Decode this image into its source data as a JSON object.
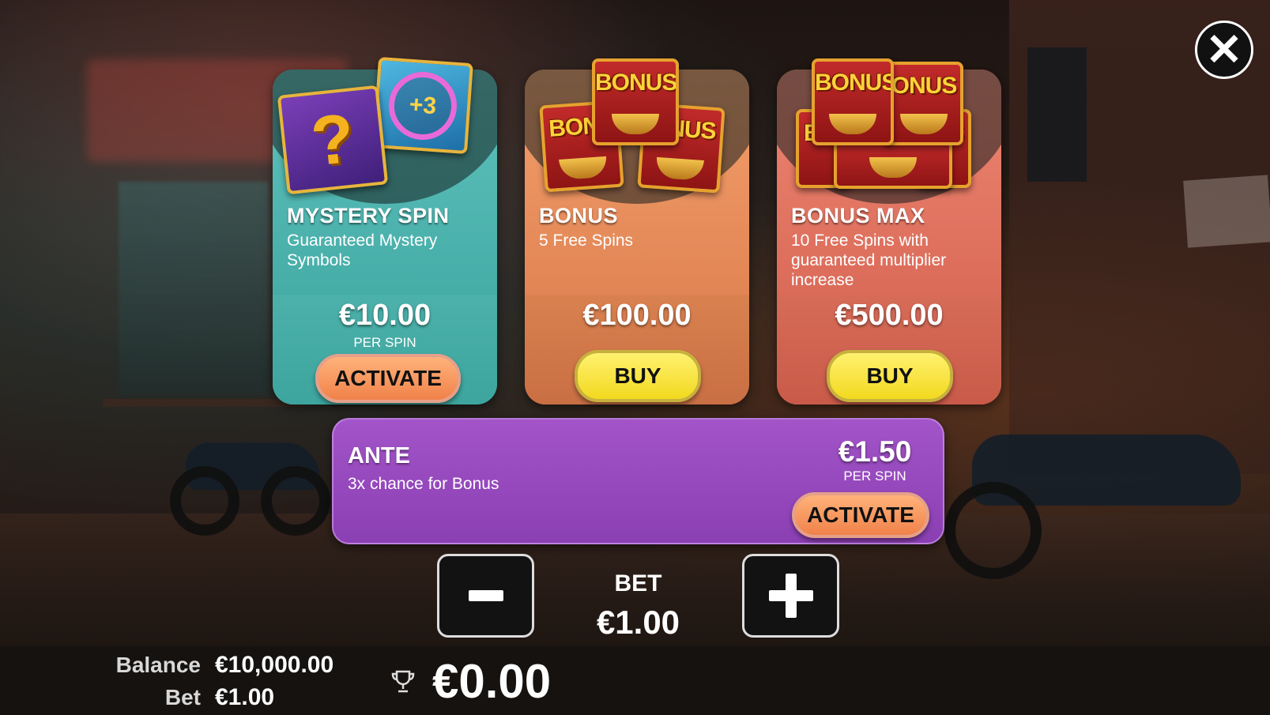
{
  "close": {
    "icon": "close-icon",
    "symbol": "✕"
  },
  "cards": [
    {
      "title": "MYSTERY SPIN",
      "desc": "Guaranteed Mystery Symbols",
      "price": "€10.00",
      "sub": "PER SPIN",
      "button": "ACTIVATE"
    },
    {
      "title": "BONUS",
      "desc": "5 Free Spins",
      "price": "€100.00",
      "button": "BUY"
    },
    {
      "title": "BONUS MAX",
      "desc": "10 Free Spins with guaranteed multiplier increase",
      "price": "€500.00",
      "button": "BUY"
    }
  ],
  "art": {
    "mystery_q": "?",
    "mystery_ring": "+3",
    "bonus_word": "BONUS",
    "bonus_partial_left": "BON",
    "bonus_partial_right": "NUS",
    "bonus_partial_far_left": "B",
    "bonus_partial_far_right": "S",
    "bonus_partial_onus": "ONUS"
  },
  "ante": {
    "title": "ANTE",
    "desc": "3x chance for Bonus",
    "price": "€1.50",
    "sub": "PER SPIN",
    "button": "ACTIVATE"
  },
  "bet": {
    "label": "BET",
    "value": "€1.00",
    "minus_icon": "minus-icon",
    "plus_icon": "plus-icon"
  },
  "footer": {
    "balance_label": "Balance",
    "balance_value": "€10,000.00",
    "bet_label": "Bet",
    "bet_value": "€1.00",
    "win_value": "€0.00",
    "trophy_icon": "trophy-icon"
  },
  "colors": {
    "mystery": "#4cb1aa",
    "bonus": "#d9814f",
    "bonus_max": "#d66c58",
    "ante": "#9a4cc2",
    "activate": "#f59a62",
    "buy": "#f6e23a"
  }
}
